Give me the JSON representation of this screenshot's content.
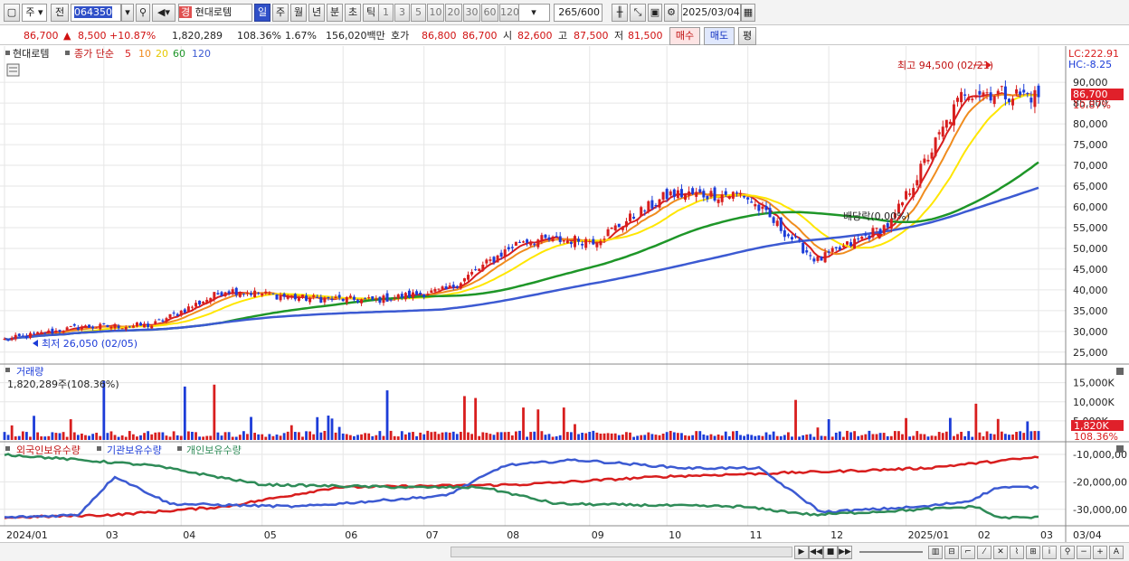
{
  "toolbar": {
    "market_label": "주",
    "prev_label": "전",
    "stock_code": "064350",
    "stock_name": "현대로템",
    "stock_badge": "경",
    "periods": [
      "일",
      "주",
      "월",
      "년",
      "분",
      "초",
      "틱"
    ],
    "active_period": "일",
    "intervals": [
      "1",
      "3",
      "5",
      "10",
      "20",
      "30",
      "60",
      "120"
    ],
    "count_text": "265/600",
    "date_text": "2025/03/04"
  },
  "quote": {
    "price": "86,700",
    "change": "8,500 +10.87%",
    "volume": "1,820,289",
    "volume_ratio": "108.36%",
    "turnover": "1.67%",
    "amount": "156,020백만",
    "bid_label": "호가",
    "bid": "86,800",
    "ask": "86,700",
    "open_label": "시",
    "open": "82,600",
    "high_label": "고",
    "high": "87,500",
    "low_label": "저",
    "low": "81,500",
    "buy_label": "매수",
    "sell_label": "매도",
    "eval_label": "평"
  },
  "legend": {
    "name": "현대로템",
    "ma_prefix": "종가 단순",
    "ma_periods": [
      "5",
      "10",
      "20",
      "60",
      "120"
    ]
  },
  "price_panel": {
    "lc_label": "LC:222.91",
    "hc_label": "HC:-8.25",
    "max_label": "최고 94,500 (02/21)",
    "min_label": "최저 26,050 (02/05)",
    "dividend_label": "배당락(0.00%)",
    "last_price": "86,700",
    "last_change": "10.87%",
    "ticks": [
      "90,000",
      "85,000",
      "80,000",
      "75,000",
      "70,000",
      "65,000",
      "60,000",
      "55,000",
      "50,000",
      "45,000",
      "40,000",
      "35,000",
      "30,000",
      "25,000"
    ]
  },
  "volume_panel": {
    "title": "거래량",
    "value_label": "1,820,289주(108.36%)",
    "last_label": "1,820K",
    "last_ratio": "108.36%",
    "ticks": [
      "15,000K",
      "10,000K",
      "5,000K"
    ]
  },
  "holding_panel": {
    "legend": [
      "외국인보유수량",
      "기관보유수량",
      "개인보유수량"
    ],
    "ticks": [
      "-10,000,00",
      "-20,000,00",
      "-30,000,00"
    ]
  },
  "xaxis": {
    "labels": [
      "2024/01",
      "03",
      "04",
      "05",
      "06",
      "07",
      "08",
      "09",
      "10",
      "11",
      "12",
      "2025/01",
      "02",
      "03"
    ],
    "right_label": "03/04"
  },
  "colors": {
    "up": "#d81e1e",
    "down": "#1c3cd8",
    "ma5": "#d81e1e",
    "ma10": "#f08c1e",
    "ma20": "#ffe600",
    "ma60": "#1e9628",
    "ma120": "#3c5ad2",
    "foreign": "#d81e1e",
    "institution": "#3c5ad2",
    "individual": "#2e8b57"
  },
  "chart_data": {
    "type": "candlestick",
    "x_range": [
      "2024/01/02",
      "2025/03/04"
    ],
    "y_range": [
      23000,
      97000
    ],
    "price_series": [
      {
        "date": "2024/01",
        "value": 28000
      },
      {
        "date": "2024/02",
        "value": 31000
      },
      {
        "date": "2024/03",
        "value": 31500
      },
      {
        "date": "2024/04",
        "value": 40000
      },
      {
        "date": "2024/05",
        "value": 38000
      },
      {
        "date": "2024/06",
        "value": 37500
      },
      {
        "date": "2024/07",
        "value": 40000
      },
      {
        "date": "2024/08",
        "value": 52000
      },
      {
        "date": "2024/09",
        "value": 52000
      },
      {
        "date": "2024/10",
        "value": 63000
      },
      {
        "date": "2024/11",
        "value": 63000
      },
      {
        "date": "2024/12",
        "value": 47000
      },
      {
        "date": "2025/01",
        "value": 56000
      },
      {
        "date": "2025/02",
        "value": 88000
      },
      {
        "date": "2025/03/04",
        "value": 86700
      }
    ],
    "max": {
      "date": "2025/02/21",
      "value": 94500
    },
    "min": {
      "date": "2024/02/05",
      "value": 26050
    }
  }
}
